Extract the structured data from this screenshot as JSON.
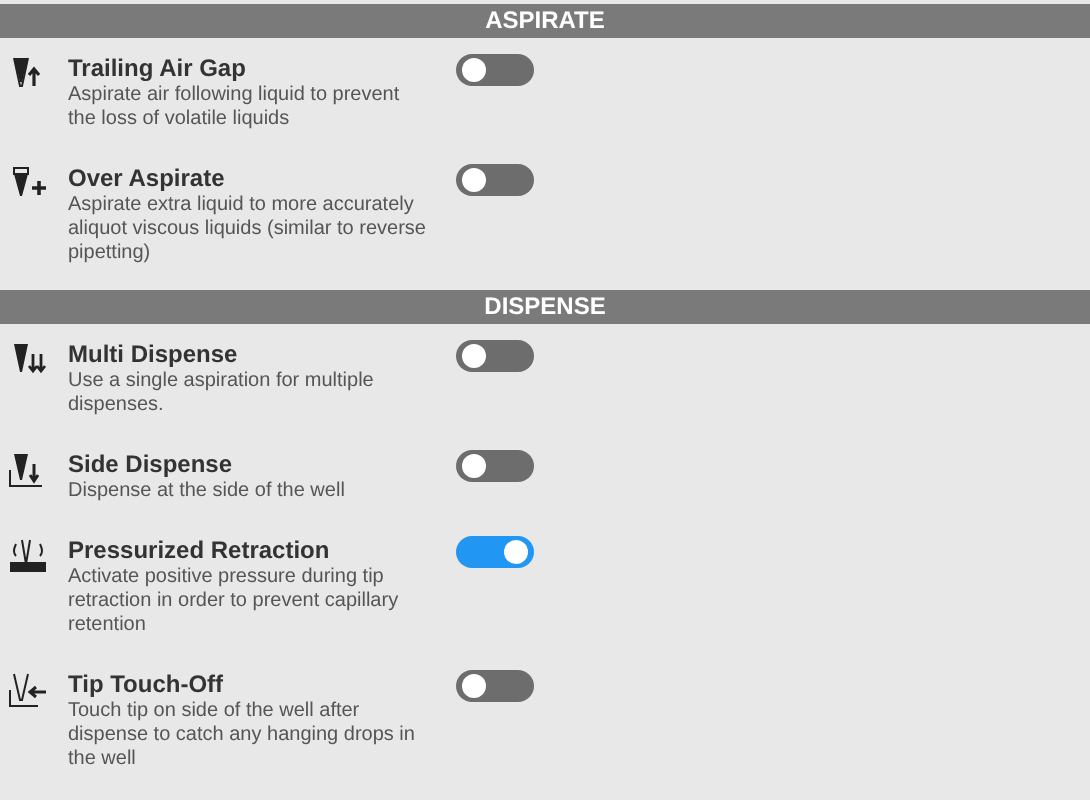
{
  "sections": [
    {
      "title": "ASPIRATE",
      "items": [
        {
          "kind": "air-gap",
          "title": "Trailing Air Gap",
          "description": "Aspirate air following liquid to prevent the loss of volatile liquids",
          "on": false
        },
        {
          "kind": "over",
          "title": "Over Aspirate",
          "description": "Aspirate extra liquid to more accurately aliquot viscous liquids (similar to reverse pipetting)",
          "on": false
        }
      ]
    },
    {
      "title": "DISPENSE",
      "items": [
        {
          "kind": "multi",
          "title": "Multi Dispense",
          "description": "Use a single aspiration for multiple dispenses.",
          "on": false
        },
        {
          "kind": "side",
          "title": "Side Dispense",
          "description": "Dispense at the side of the well",
          "on": false
        },
        {
          "kind": "pressure",
          "title": "Pressurized Retraction",
          "description": "Activate positive pressure during tip retraction in order to prevent capillary retention",
          "on": true
        },
        {
          "kind": "touch",
          "title": "Tip Touch-Off",
          "description": "Touch tip on side of the well after dispense to catch any hanging drops in the well",
          "on": false
        }
      ]
    }
  ]
}
